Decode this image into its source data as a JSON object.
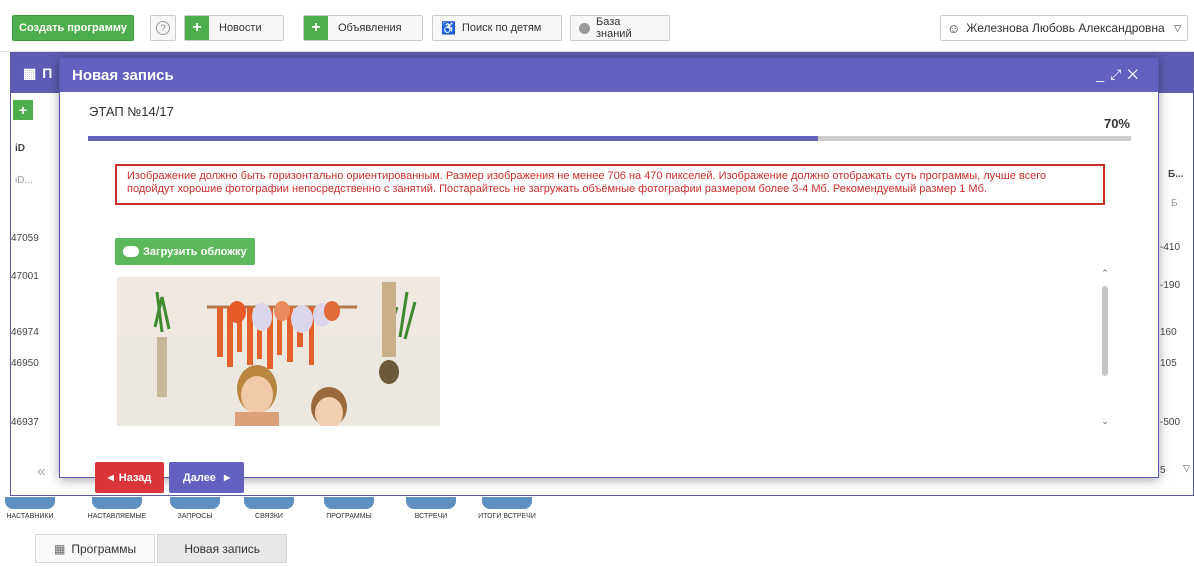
{
  "toolbar": {
    "create_program": "Создать программу",
    "help_icon": "question-circle-icon",
    "news": "Новости",
    "announcements": "Объявления",
    "child_search": "Поиск по детям",
    "knowledge_base": "База знаний",
    "user_name": "Железнова Любовь Александровна"
  },
  "background_window": {
    "title": "П",
    "column_id_header": "iD",
    "column_id_filter": "iD...",
    "column_right_header": "Б...",
    "column_right_filter": "Б",
    "rows": [
      {
        "id": "47059",
        "right": "-410"
      },
      {
        "id": "47001",
        "right": "-190"
      },
      {
        "id": "46974",
        "right": "160"
      },
      {
        "id": "46950",
        "right": "105"
      },
      {
        "id": "46937",
        "right": "-500"
      }
    ],
    "pager_prev": "«",
    "pager_right": "5"
  },
  "bottom_nav": [
    {
      "label": "НАСТАВНИКИ"
    },
    {
      "label": "НАСТАВЛЯЕМЫЕ"
    },
    {
      "label": "ЗАПРОСЫ"
    },
    {
      "label": "СВЯЗКИ"
    },
    {
      "label": "ПРОГРАММЫ"
    },
    {
      "label": "ВСТРЕЧИ"
    },
    {
      "label": "ИТОГИ ВСТРЕЧИ"
    }
  ],
  "tabs": [
    {
      "label": "Программы"
    },
    {
      "label": "Новая запись"
    }
  ],
  "modal": {
    "title": "Новая запись",
    "step": "ЭТАП №14/17",
    "progress_percent": 70,
    "progress_label": "70%",
    "error_text": "Изображение должно быть горизонтально ориентированным. Размер изображения не менее 706 на 470 пикселей. Изображение должно отображать суть программы, лучше всего подойдут хорошие фотографии непосредственно с занятий. Постарайтесь не загружать объёмные фотографии размером более 3-4 Мб. Рекомендуемый размер 1 Мб.",
    "upload_label": "Загрузить обложку",
    "back_label": "Назад",
    "next_label": "Далее"
  },
  "colors": {
    "brand_purple": "#6360c0",
    "success_green": "#5cb85c",
    "danger_red": "#d9353a"
  }
}
